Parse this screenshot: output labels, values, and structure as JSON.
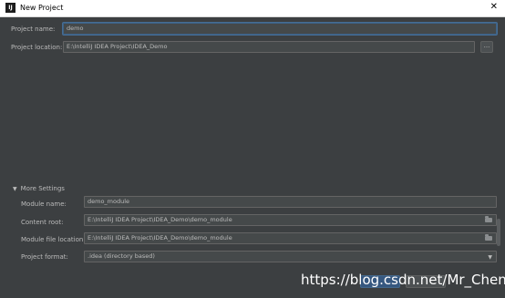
{
  "window": {
    "title": "New Project",
    "app_icon_text": "IJ",
    "close_symbol": "✕"
  },
  "fields": {
    "project_name_label": "Project name:",
    "project_name_value": "demo",
    "project_location_label": "Project location:",
    "project_location_value": "E:\\IntelliJ IDEA Project\\IDEA_Demo",
    "browse_label": "..."
  },
  "more_settings": {
    "toggle_label": "More Settings",
    "module_name_label": "Module name:",
    "module_name_value": "demo_module",
    "content_root_label": "Content root:",
    "content_root_value": "E:\\IntelliJ IDEA Project\\IDEA_Demo\\demo_module",
    "module_file_location_label": "Module file location:",
    "module_file_location_value": "E:\\IntelliJ IDEA Project\\IDEA_Demo\\demo_module",
    "project_format_label": "Project format:",
    "project_format_value": ".idea (directory based)"
  },
  "watermark": "https://blog.csdn.net/Mr_Chenn"
}
